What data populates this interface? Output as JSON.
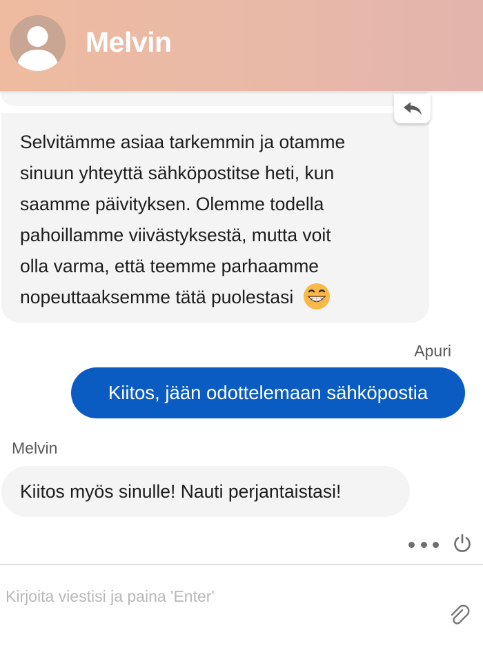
{
  "header": {
    "contact_name": "Melvin",
    "avatar_icon": "user-silhouette-icon",
    "background_colors": [
      "#eebba0",
      "#e2b4ac"
    ]
  },
  "messages": [
    {
      "direction": "incoming",
      "lines": [
        "Selvitämme asiaa tarkemmin ja otamme",
        "sinuun yhteyttä sähköpostitse heti, kun",
        "saamme päivityksen. Olemme todella",
        "pahoillamme viivästyksestä, mutta voit",
        "olla varma, että teemme parhaamme",
        "nopeuttaaksemme tätä puolestasi"
      ],
      "emoji": "grinning-face-emoji"
    },
    {
      "direction": "outgoing",
      "sender": "Apuri",
      "text": "Kiitos, jään odottelemaan sähköpostia"
    },
    {
      "direction": "incoming",
      "sender": "Melvin",
      "text": "Kiitos myös sinulle! Nauti perjantaistasi!"
    }
  ],
  "actions": {
    "reply_icon": "reply-arrow-icon",
    "more_icon": "more-dots-icon",
    "power_icon": "power-icon",
    "attach_icon": "paperclip-icon"
  },
  "composer": {
    "placeholder": "Kirjoita viestisi ja paina 'Enter'",
    "value": ""
  },
  "colors": {
    "outgoing_bubble": "#0b5cc2",
    "incoming_bubble": "#f4f4f4"
  }
}
